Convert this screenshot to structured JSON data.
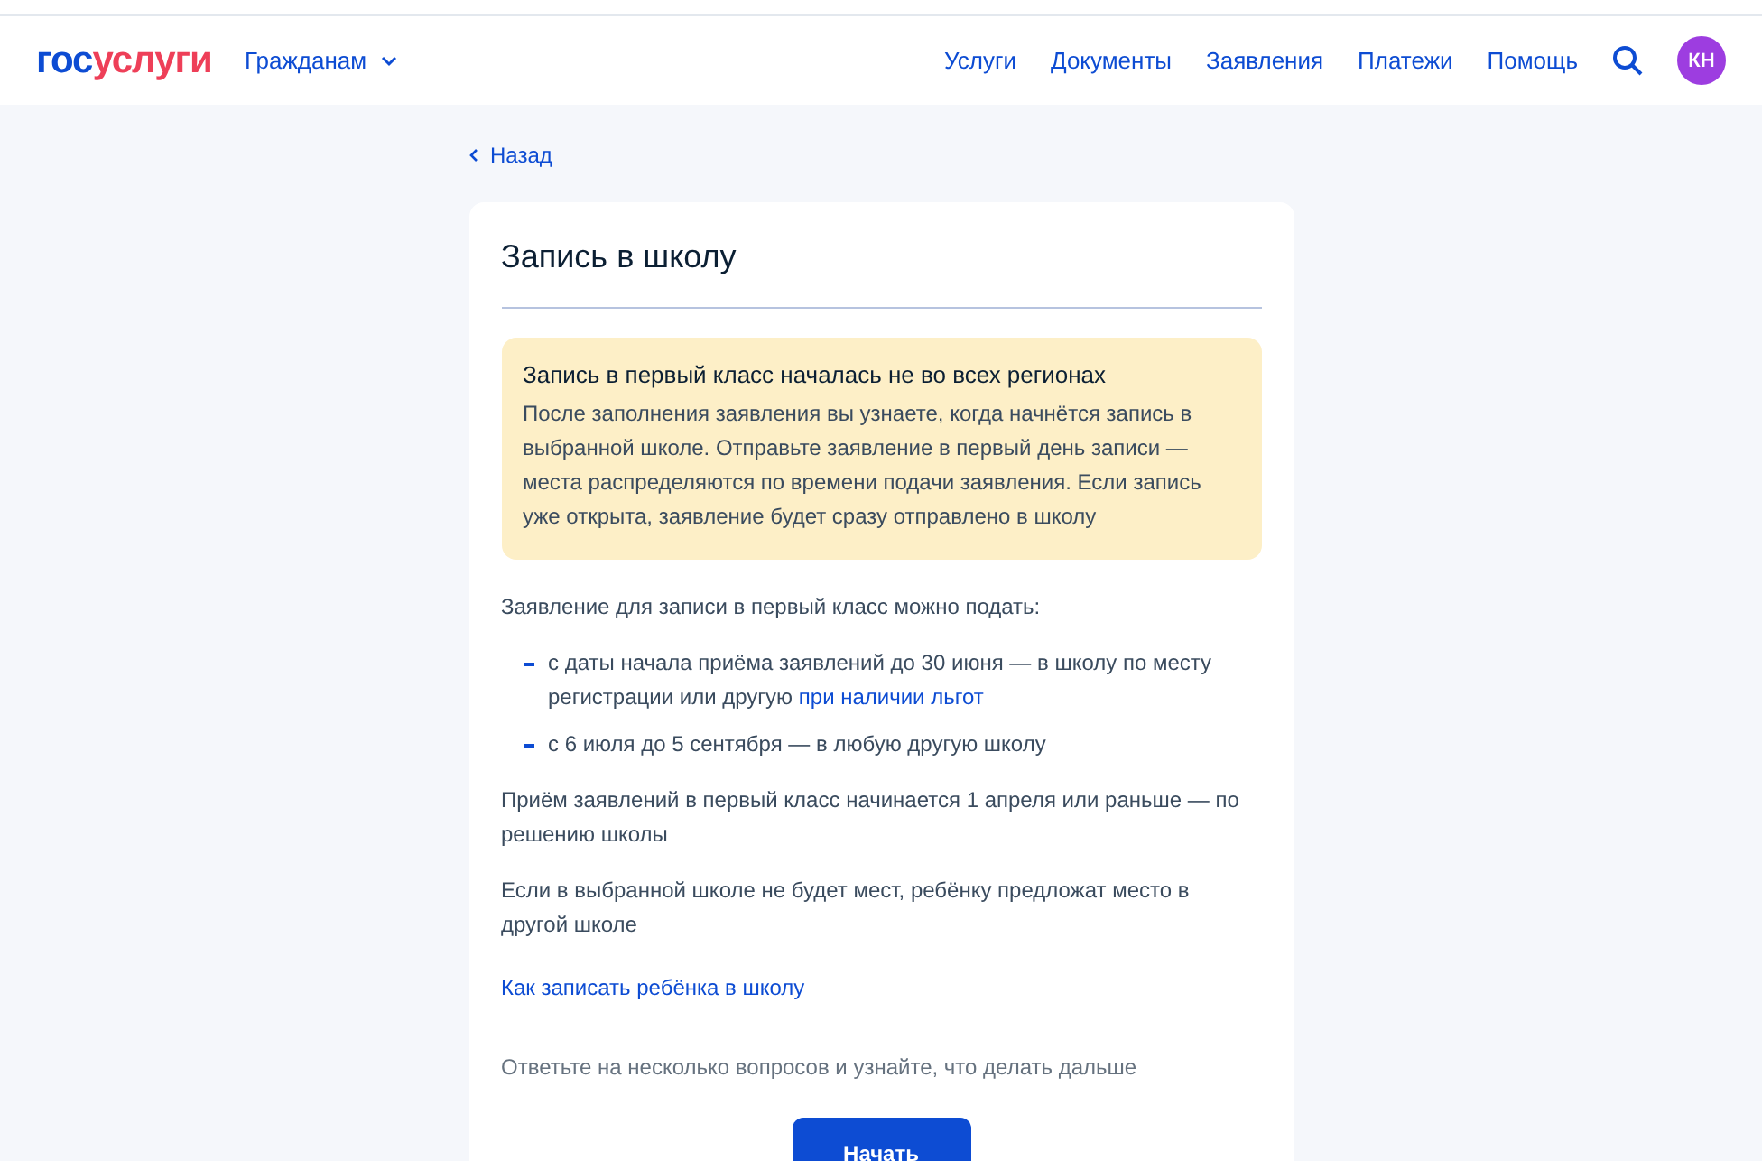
{
  "header": {
    "logo": {
      "first": "гос",
      "second": "услуги"
    },
    "audience_menu": "Гражданам",
    "nav": [
      "Услуги",
      "Документы",
      "Заявления",
      "Платежи",
      "Помощь"
    ],
    "avatar": "КН"
  },
  "back_link": "Назад",
  "card": {
    "title": "Запись в школу",
    "notice": {
      "title": "Запись в первый класс началась не во всех регионах",
      "text": "После заполнения заявления вы узнаете, когда начнётся запись в выбранной школе. Отправьте заявление в первый день записи — места распределяются по времени подачи заявления. Если запись уже открыта, заявление будет сразу отправлено в школу"
    },
    "intro": "Заявление для записи в первый класс можно подать:",
    "list": [
      {
        "text": "с даты начала приёма заявлений до 30 июня — в школу по месту регистрации или другую ",
        "link": "при наличии льгот"
      },
      {
        "text": "с 6 июля до 5 сентября — в любую другую школу"
      }
    ],
    "paragraphs": [
      "Приём заявлений в первый класс начинается 1 апреля или раньше — по решению школы",
      "Если в выбранной школе не будет мест, ребёнку предложат место в другой школе"
    ],
    "help_link": "Как записать ребёнка в школу",
    "prompt": "Ответьте на несколько вопросов и узнайте, что делать дальше",
    "start_button": "Начать"
  }
}
